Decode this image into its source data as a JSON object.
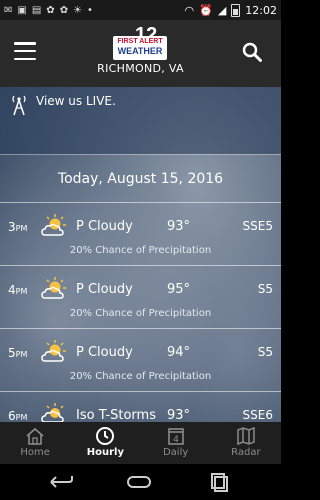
{
  "status": {
    "time": "12:02",
    "left_icons": [
      "message-icon",
      "image-icon",
      "sms-icon",
      "nbc-icon",
      "nbc-icon",
      "weather-icon",
      "more-icon"
    ],
    "right_icons": [
      "wifi-icon",
      "alarm-icon",
      "signal-icon",
      "battery-icon"
    ]
  },
  "header": {
    "logo_number": "12",
    "logo_line1": "FIRST ALERT",
    "logo_line2": "WEATHER",
    "city": "RICHMOND, VA"
  },
  "live": {
    "label": "View us LIVE."
  },
  "date_label": "Today, August 15, 2016",
  "hours": [
    {
      "hour": "3",
      "meridiem": "PM",
      "icon": "partly-cloudy-icon",
      "condition": "P Cloudy",
      "temp": "93°",
      "wind": "SSE5",
      "precip": "20% Chance of Precipitation"
    },
    {
      "hour": "4",
      "meridiem": "PM",
      "icon": "partly-cloudy-icon",
      "condition": "P Cloudy",
      "temp": "95°",
      "wind": "S5",
      "precip": "20% Chance of Precipitation"
    },
    {
      "hour": "5",
      "meridiem": "PM",
      "icon": "partly-cloudy-icon",
      "condition": "P Cloudy",
      "temp": "94°",
      "wind": "S5",
      "precip": "20% Chance of Precipitation"
    },
    {
      "hour": "6",
      "meridiem": "PM",
      "icon": "thunderstorm-icon",
      "condition": "Iso T-Storms",
      "temp": "93°",
      "wind": "SSE6",
      "precip": ""
    }
  ],
  "tabs": [
    {
      "label": "Home",
      "icon": "home-icon"
    },
    {
      "label": "Hourly",
      "icon": "clock-icon"
    },
    {
      "label": "Daily",
      "icon": "calendar-icon",
      "badge": "4"
    },
    {
      "label": "Radar",
      "icon": "map-icon"
    }
  ],
  "colors": {
    "app_bar": "#2a2a2a",
    "tab_bar": "#1f1f1f",
    "logo_red": "#c8102e",
    "logo_blue": "#1e3f8c",
    "sun": "#f5c242"
  }
}
